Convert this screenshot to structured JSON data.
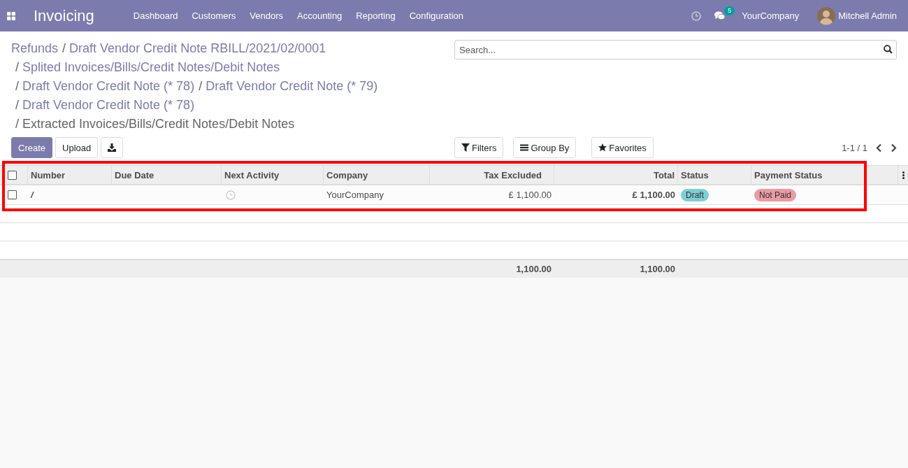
{
  "app": {
    "title": "Invoicing",
    "menu": [
      "Dashboard",
      "Customers",
      "Vendors",
      "Accounting",
      "Reporting",
      "Configuration"
    ]
  },
  "systray": {
    "message_count": "5",
    "company": "YourCompany",
    "user": "Mitchell Admin"
  },
  "breadcrumbs": [
    {
      "label": "Refunds",
      "active": false
    },
    {
      "separator": "/",
      "label": "Draft Vendor Credit Note RBILL/2021/02/0001",
      "active": false
    },
    {
      "separator": "/",
      "label": "Splited Invoices/Bills/Credit Notes/Debit Notes",
      "active": false
    },
    {
      "separator": "/",
      "label": "Draft Vendor Credit Note (* 78)",
      "active": false
    },
    {
      "separator": "/",
      "label": "Draft Vendor Credit Note (* 79)",
      "active": false
    },
    {
      "separator": "/",
      "label": "Draft Vendor Credit Note (* 78)",
      "active": false
    },
    {
      "separator": "/",
      "label": "Extracted Invoices/Bills/Credit Notes/Debit Notes",
      "active": true
    }
  ],
  "search": {
    "placeholder": "Search..."
  },
  "buttons": [
    {
      "label": "Create",
      "kind": "primary"
    },
    {
      "label": "Upload",
      "kind": "secondary"
    },
    {
      "kind": "download"
    }
  ],
  "search_options": [
    {
      "label": "Filters",
      "kind": "filter"
    },
    {
      "label": "Group By",
      "kind": "group"
    },
    {
      "label": "Favorites",
      "kind": "favorite"
    }
  ],
  "pager": "1-1 / 1",
  "table": {
    "select_all_checked": false,
    "columns": [
      {
        "label": "Number",
        "numeric": false
      },
      {
        "label": "Due Date",
        "numeric": false
      },
      {
        "label": "Next Activity",
        "numeric": false
      },
      {
        "label": "Company",
        "numeric": false
      },
      {
        "label": "Tax Excluded",
        "numeric": true
      },
      {
        "label": "Total",
        "numeric": true
      },
      {
        "label": "Status",
        "numeric": false
      },
      {
        "label": "Payment Status",
        "numeric": false
      }
    ],
    "rows": [
      {
        "checked": false,
        "number": "/",
        "company": "YourCompany",
        "tax_excluded": "£ 1,100.00",
        "total": "£ 1,100.00",
        "status": {
          "label": "Draft",
          "color": "#7dcfd6"
        },
        "payment_status": {
          "label": "Not Paid",
          "color": "#eb9ba4"
        }
      }
    ],
    "totals": {
      "tax_excluded": "1,100.00",
      "total": "1,100.00"
    }
  }
}
